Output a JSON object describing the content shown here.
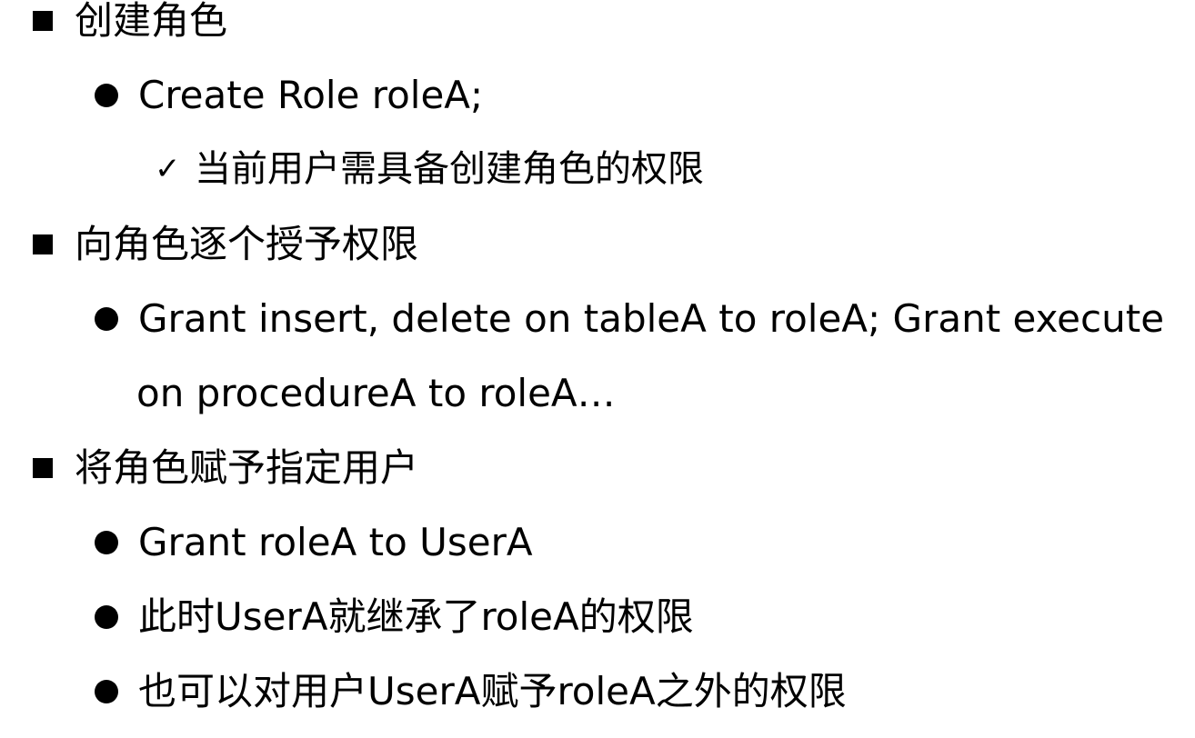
{
  "sections": [
    {
      "heading": "创建角色",
      "bullets": [
        {
          "text": "Create Role roleA;",
          "subitems": [
            "当前用户需具备创建角色的权限"
          ]
        }
      ]
    },
    {
      "heading": "向角色逐个授予权限",
      "bullets": [
        {
          "text": "Grant insert, delete on tableA to roleA; Grant execute",
          "continuation": "on procedureA to roleA…"
        }
      ]
    },
    {
      "heading": "将角色赋予指定用户",
      "bullets": [
        {
          "text": "Grant roleA to UserA"
        },
        {
          "text": "此时UserA就继承了roleA的权限"
        },
        {
          "text": "也可以对用户UserA赋予roleA之外的权限"
        }
      ]
    }
  ],
  "icons": {
    "level1": "square-bullet-icon",
    "level2": "round-bullet-icon",
    "level3": "checkmark-icon"
  }
}
